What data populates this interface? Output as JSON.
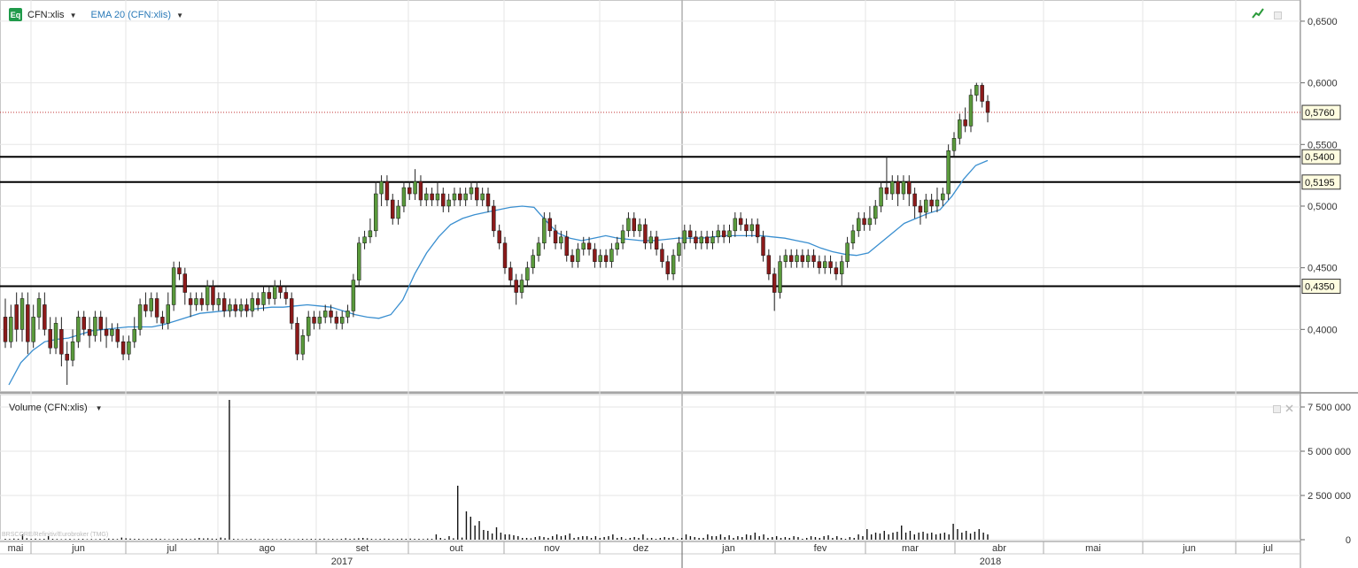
{
  "header": {
    "symbol_label": "CFN:xlis",
    "indicator_label": "EMA 20 (CFN:xlis)",
    "logo_text": "Eq",
    "caret": "▼",
    "volume_label": "Volume (CFN:xlis)"
  },
  "watermark": "BRSCORE/Refinitiv/Eurobroker (TMG)",
  "icons": [
    "chart-type-icon",
    "maximize-icon",
    "pane-settings-icon",
    "close-pane-icon"
  ],
  "colors": {
    "up": "#5a9a3c",
    "down": "#8b1a1a",
    "wick": "#222222",
    "ema": "#3a8fd0",
    "hline": "#000000",
    "last_price_line": "#c03030",
    "grid": "#e6e6e6",
    "grid_major": "#b0b0b0"
  },
  "chart_data": {
    "type": "candlestick",
    "price_axis": {
      "range": [
        0.35,
        0.66
      ],
      "ticks": [
        "0,4000",
        "0,4500",
        "0,5000",
        "0,5500",
        "0,6000",
        "0,6500"
      ],
      "tick_values": [
        0.4,
        0.45,
        0.5,
        0.55,
        0.6,
        0.65
      ]
    },
    "volume_axis": {
      "range": [
        0,
        8000000
      ],
      "ticks": [
        "0",
        "2 500 000",
        "5 000 000",
        "7 500 000"
      ],
      "tick_values": [
        0,
        2500000,
        5000000,
        7500000
      ]
    },
    "horizontal_lines": [
      {
        "value": 0.54,
        "label": "0,5400"
      },
      {
        "value": 0.5195,
        "label": "0,5195"
      },
      {
        "value": 0.435,
        "label": "0,4350"
      }
    ],
    "last_price": {
      "value": 0.576,
      "label": "0,5760"
    },
    "x_axis": {
      "months": [
        {
          "label": "mai",
          "at": 2017.33
        },
        {
          "label": "jun",
          "at": 2017.42
        },
        {
          "label": "jul",
          "at": 2017.5
        },
        {
          "label": "ago",
          "at": 2017.58
        },
        {
          "label": "set",
          "at": 2017.67
        },
        {
          "label": "out",
          "at": 2017.75
        },
        {
          "label": "nov",
          "at": 2017.83
        },
        {
          "label": "dez",
          "at": 2017.92
        },
        {
          "label": "jan",
          "at": 2018.0
        },
        {
          "label": "fev",
          "at": 2018.08
        },
        {
          "label": "mar",
          "at": 2018.17
        },
        {
          "label": "abr",
          "at": 2018.25
        },
        {
          "label": "mai",
          "at": 2018.33
        },
        {
          "label": "jun",
          "at": 2018.42
        },
        {
          "label": "jul",
          "at": 2018.5
        }
      ],
      "years": [
        {
          "label": "2017"
        },
        {
          "label": "2018"
        }
      ]
    },
    "ema_series": [
      0.355,
      0.373,
      0.383,
      0.39,
      0.392,
      0.393,
      0.396,
      0.399,
      0.4,
      0.401,
      0.402,
      0.402,
      0.402,
      0.404,
      0.407,
      0.41,
      0.413,
      0.414,
      0.415,
      0.416,
      0.416,
      0.417,
      0.418,
      0.418,
      0.419,
      0.42,
      0.419,
      0.418,
      0.415,
      0.412,
      0.41,
      0.409,
      0.412,
      0.424,
      0.445,
      0.462,
      0.475,
      0.485,
      0.49,
      0.493,
      0.495,
      0.497,
      0.499,
      0.5,
      0.499,
      0.488,
      0.478,
      0.474,
      0.472,
      0.474,
      0.476,
      0.474,
      0.473,
      0.472,
      0.472,
      0.473,
      0.474,
      0.474,
      0.474,
      0.475,
      0.476,
      0.476,
      0.476,
      0.476,
      0.475,
      0.474,
      0.472,
      0.47,
      0.466,
      0.463,
      0.461,
      0.46,
      0.462,
      0.47,
      0.478,
      0.486,
      0.49,
      0.494,
      0.497,
      0.508,
      0.522,
      0.533,
      0.537
    ],
    "candles": [
      [
        0.41,
        0.39,
        0.425,
        0.385
      ],
      [
        0.39,
        0.41,
        0.42,
        0.385
      ],
      [
        0.42,
        0.4,
        0.43,
        0.39
      ],
      [
        0.4,
        0.425,
        0.43,
        0.39
      ],
      [
        0.42,
        0.39,
        0.43,
        0.38
      ],
      [
        0.39,
        0.41,
        0.42,
        0.385
      ],
      [
        0.41,
        0.425,
        0.43,
        0.4
      ],
      [
        0.42,
        0.4,
        0.43,
        0.395
      ],
      [
        0.4,
        0.385,
        0.41,
        0.38
      ],
      [
        0.385,
        0.405,
        0.41,
        0.38
      ],
      [
        0.4,
        0.38,
        0.41,
        0.37
      ],
      [
        0.38,
        0.375,
        0.39,
        0.355
      ],
      [
        0.375,
        0.39,
        0.4,
        0.37
      ],
      [
        0.39,
        0.41,
        0.415,
        0.385
      ],
      [
        0.41,
        0.4,
        0.415,
        0.395
      ],
      [
        0.4,
        0.395,
        0.41,
        0.385
      ],
      [
        0.395,
        0.41,
        0.415,
        0.39
      ],
      [
        0.41,
        0.4,
        0.415,
        0.39
      ],
      [
        0.4,
        0.395,
        0.41,
        0.385
      ],
      [
        0.395,
        0.4,
        0.405,
        0.39
      ],
      [
        0.4,
        0.39,
        0.405,
        0.385
      ],
      [
        0.39,
        0.38,
        0.395,
        0.375
      ],
      [
        0.38,
        0.39,
        0.395,
        0.375
      ],
      [
        0.39,
        0.4,
        0.41,
        0.385
      ],
      [
        0.4,
        0.42,
        0.425,
        0.395
      ],
      [
        0.42,
        0.415,
        0.43,
        0.41
      ],
      [
        0.415,
        0.425,
        0.43,
        0.41
      ],
      [
        0.425,
        0.41,
        0.43,
        0.405
      ],
      [
        0.41,
        0.405,
        0.415,
        0.4
      ],
      [
        0.405,
        0.42,
        0.43,
        0.4
      ],
      [
        0.42,
        0.45,
        0.455,
        0.415
      ],
      [
        0.45,
        0.445,
        0.455,
        0.44
      ],
      [
        0.445,
        0.43,
        0.45,
        0.42
      ],
      [
        0.425,
        0.42,
        0.43,
        0.41
      ],
      [
        0.42,
        0.425,
        0.43,
        0.415
      ],
      [
        0.425,
        0.42,
        0.43,
        0.415
      ],
      [
        0.42,
        0.435,
        0.44,
        0.415
      ],
      [
        0.435,
        0.42,
        0.44,
        0.415
      ],
      [
        0.42,
        0.425,
        0.43,
        0.415
      ],
      [
        0.425,
        0.415,
        0.43,
        0.41
      ],
      [
        0.415,
        0.42,
        0.425,
        0.41
      ],
      [
        0.42,
        0.415,
        0.425,
        0.41
      ],
      [
        0.415,
        0.42,
        0.425,
        0.41
      ],
      [
        0.42,
        0.415,
        0.425,
        0.41
      ],
      [
        0.415,
        0.425,
        0.43,
        0.41
      ],
      [
        0.425,
        0.42,
        0.43,
        0.415
      ],
      [
        0.42,
        0.43,
        0.435,
        0.415
      ],
      [
        0.43,
        0.425,
        0.435,
        0.42
      ],
      [
        0.425,
        0.435,
        0.44,
        0.42
      ],
      [
        0.435,
        0.43,
        0.44,
        0.425
      ],
      [
        0.43,
        0.425,
        0.435,
        0.42
      ],
      [
        0.425,
        0.405,
        0.43,
        0.4
      ],
      [
        0.405,
        0.38,
        0.41,
        0.375
      ],
      [
        0.38,
        0.395,
        0.4,
        0.375
      ],
      [
        0.395,
        0.41,
        0.415,
        0.39
      ],
      [
        0.41,
        0.405,
        0.415,
        0.4
      ],
      [
        0.405,
        0.41,
        0.415,
        0.4
      ],
      [
        0.41,
        0.415,
        0.42,
        0.405
      ],
      [
        0.415,
        0.41,
        0.42,
        0.405
      ],
      [
        0.41,
        0.405,
        0.415,
        0.4
      ],
      [
        0.405,
        0.41,
        0.415,
        0.4
      ],
      [
        0.41,
        0.415,
        0.42,
        0.405
      ],
      [
        0.415,
        0.44,
        0.445,
        0.41
      ],
      [
        0.44,
        0.47,
        0.475,
        0.435
      ],
      [
        0.47,
        0.475,
        0.48,
        0.465
      ],
      [
        0.475,
        0.48,
        0.49,
        0.47
      ],
      [
        0.48,
        0.51,
        0.52,
        0.475
      ],
      [
        0.51,
        0.52,
        0.525,
        0.5
      ],
      [
        0.52,
        0.505,
        0.525,
        0.5
      ],
      [
        0.505,
        0.49,
        0.51,
        0.485
      ],
      [
        0.49,
        0.5,
        0.505,
        0.485
      ],
      [
        0.5,
        0.515,
        0.52,
        0.495
      ],
      [
        0.515,
        0.51,
        0.52,
        0.505
      ],
      [
        0.51,
        0.52,
        0.53,
        0.505
      ],
      [
        0.52,
        0.505,
        0.525,
        0.5
      ],
      [
        0.505,
        0.51,
        0.515,
        0.5
      ],
      [
        0.51,
        0.505,
        0.515,
        0.5
      ],
      [
        0.505,
        0.51,
        0.52,
        0.5
      ],
      [
        0.51,
        0.5,
        0.515,
        0.495
      ],
      [
        0.5,
        0.505,
        0.51,
        0.495
      ],
      [
        0.505,
        0.51,
        0.515,
        0.5
      ],
      [
        0.51,
        0.505,
        0.515,
        0.5
      ],
      [
        0.505,
        0.51,
        0.515,
        0.5
      ],
      [
        0.51,
        0.515,
        0.52,
        0.505
      ],
      [
        0.515,
        0.505,
        0.52,
        0.5
      ],
      [
        0.505,
        0.51,
        0.515,
        0.5
      ],
      [
        0.51,
        0.5,
        0.515,
        0.495
      ],
      [
        0.5,
        0.48,
        0.505,
        0.475
      ],
      [
        0.48,
        0.47,
        0.485,
        0.465
      ],
      [
        0.47,
        0.45,
        0.475,
        0.445
      ],
      [
        0.45,
        0.44,
        0.455,
        0.435
      ],
      [
        0.44,
        0.43,
        0.445,
        0.42
      ],
      [
        0.43,
        0.44,
        0.445,
        0.425
      ],
      [
        0.44,
        0.45,
        0.455,
        0.435
      ],
      [
        0.45,
        0.46,
        0.465,
        0.445
      ],
      [
        0.46,
        0.47,
        0.475,
        0.455
      ],
      [
        0.47,
        0.49,
        0.495,
        0.465
      ],
      [
        0.49,
        0.48,
        0.495,
        0.475
      ],
      [
        0.48,
        0.47,
        0.485,
        0.465
      ],
      [
        0.47,
        0.475,
        0.48,
        0.465
      ],
      [
        0.475,
        0.46,
        0.48,
        0.455
      ],
      [
        0.46,
        0.455,
        0.465,
        0.45
      ],
      [
        0.455,
        0.465,
        0.47,
        0.45
      ],
      [
        0.465,
        0.47,
        0.475,
        0.46
      ],
      [
        0.47,
        0.465,
        0.475,
        0.46
      ],
      [
        0.465,
        0.455,
        0.47,
        0.45
      ],
      [
        0.455,
        0.46,
        0.465,
        0.45
      ],
      [
        0.46,
        0.455,
        0.465,
        0.45
      ],
      [
        0.455,
        0.465,
        0.47,
        0.45
      ],
      [
        0.465,
        0.47,
        0.475,
        0.46
      ],
      [
        0.47,
        0.48,
        0.485,
        0.465
      ],
      [
        0.48,
        0.49,
        0.495,
        0.475
      ],
      [
        0.49,
        0.48,
        0.495,
        0.475
      ],
      [
        0.48,
        0.485,
        0.49,
        0.475
      ],
      [
        0.485,
        0.47,
        0.49,
        0.465
      ],
      [
        0.47,
        0.475,
        0.48,
        0.465
      ],
      [
        0.475,
        0.465,
        0.48,
        0.46
      ],
      [
        0.465,
        0.455,
        0.47,
        0.45
      ],
      [
        0.455,
        0.445,
        0.46,
        0.44
      ],
      [
        0.445,
        0.46,
        0.465,
        0.44
      ],
      [
        0.46,
        0.47,
        0.475,
        0.455
      ],
      [
        0.47,
        0.48,
        0.485,
        0.465
      ],
      [
        0.48,
        0.475,
        0.485,
        0.47
      ],
      [
        0.475,
        0.47,
        0.48,
        0.465
      ],
      [
        0.47,
        0.475,
        0.48,
        0.465
      ],
      [
        0.475,
        0.47,
        0.48,
        0.465
      ],
      [
        0.47,
        0.475,
        0.48,
        0.465
      ],
      [
        0.475,
        0.48,
        0.485,
        0.47
      ],
      [
        0.48,
        0.475,
        0.485,
        0.47
      ],
      [
        0.475,
        0.48,
        0.485,
        0.47
      ],
      [
        0.48,
        0.49,
        0.495,
        0.475
      ],
      [
        0.49,
        0.485,
        0.495,
        0.48
      ],
      [
        0.485,
        0.48,
        0.49,
        0.475
      ],
      [
        0.48,
        0.485,
        0.49,
        0.475
      ],
      [
        0.485,
        0.475,
        0.49,
        0.47
      ],
      [
        0.475,
        0.46,
        0.48,
        0.455
      ],
      [
        0.46,
        0.445,
        0.465,
        0.44
      ],
      [
        0.445,
        0.43,
        0.45,
        0.415
      ],
      [
        0.43,
        0.455,
        0.46,
        0.425
      ],
      [
        0.455,
        0.46,
        0.465,
        0.45
      ],
      [
        0.46,
        0.455,
        0.465,
        0.45
      ],
      [
        0.455,
        0.46,
        0.465,
        0.45
      ],
      [
        0.46,
        0.455,
        0.465,
        0.45
      ],
      [
        0.455,
        0.46,
        0.465,
        0.45
      ],
      [
        0.46,
        0.455,
        0.465,
        0.45
      ],
      [
        0.455,
        0.45,
        0.46,
        0.445
      ],
      [
        0.45,
        0.455,
        0.46,
        0.445
      ],
      [
        0.455,
        0.45,
        0.46,
        0.445
      ],
      [
        0.45,
        0.445,
        0.455,
        0.44
      ],
      [
        0.445,
        0.455,
        0.46,
        0.435
      ],
      [
        0.455,
        0.47,
        0.475,
        0.45
      ],
      [
        0.47,
        0.48,
        0.485,
        0.465
      ],
      [
        0.48,
        0.49,
        0.495,
        0.475
      ],
      [
        0.49,
        0.485,
        0.495,
        0.48
      ],
      [
        0.485,
        0.49,
        0.5,
        0.48
      ],
      [
        0.49,
        0.5,
        0.505,
        0.485
      ],
      [
        0.5,
        0.515,
        0.52,
        0.495
      ],
      [
        0.515,
        0.51,
        0.54,
        0.505
      ],
      [
        0.51,
        0.52,
        0.525,
        0.505
      ],
      [
        0.52,
        0.51,
        0.525,
        0.5
      ],
      [
        0.51,
        0.52,
        0.525,
        0.505
      ],
      [
        0.52,
        0.51,
        0.525,
        0.5
      ],
      [
        0.51,
        0.5,
        0.515,
        0.49
      ],
      [
        0.5,
        0.495,
        0.505,
        0.485
      ],
      [
        0.495,
        0.505,
        0.51,
        0.49
      ],
      [
        0.505,
        0.5,
        0.51,
        0.495
      ],
      [
        0.5,
        0.505,
        0.515,
        0.495
      ],
      [
        0.505,
        0.51,
        0.515,
        0.5
      ],
      [
        0.51,
        0.545,
        0.55,
        0.505
      ],
      [
        0.545,
        0.555,
        0.56,
        0.54
      ],
      [
        0.555,
        0.57,
        0.575,
        0.55
      ],
      [
        0.57,
        0.565,
        0.58,
        0.56
      ],
      [
        0.565,
        0.59,
        0.595,
        0.56
      ],
      [
        0.59,
        0.598,
        0.6,
        0.585
      ],
      [
        0.598,
        0.585,
        0.6,
        0.58
      ],
      [
        0.585,
        0.576,
        0.59,
        0.568
      ]
    ],
    "volumes": [
      0.05,
      0.04,
      0.06,
      0.05,
      0.3,
      0.08,
      0.05,
      0.06,
      0.04,
      0.05,
      0.2,
      0.05,
      0.04,
      0.03,
      0.04,
      0.05,
      0.03,
      0.04,
      0.05,
      0.03,
      0.04,
      0.03,
      0.05,
      0.04,
      0.06,
      0.05,
      0.04,
      0.12,
      0.08,
      0.06,
      0.05,
      0.05,
      0.04,
      0.04,
      0.05,
      0.06,
      0.05,
      0.04,
      0.03,
      0.04,
      0.05,
      0.06,
      0.05,
      0.04,
      0.06,
      0.1,
      0.07,
      0.08,
      0.06,
      0.05,
      0.12,
      0.08,
      7.9,
      0.05,
      0.04,
      0.03,
      0.04,
      0.05,
      0.04,
      0.03,
      0.04,
      0.05,
      0.04,
      0.03,
      0.04,
      0.05,
      0.04,
      0.03,
      0.04,
      0.05,
      0.04,
      0.05,
      0.04,
      0.05,
      0.06,
      0.04,
      0.05,
      0.04,
      0.05,
      0.08,
      0.05,
      0.06,
      0.08,
      0.1,
      0.08,
      0.05,
      0.04,
      0.05,
      0.06,
      0.05,
      0.04,
      0.05,
      0.06,
      0.05,
      0.06,
      0.05,
      0.05,
      0.04,
      0.06,
      0.05,
      0.3,
      0.1,
      0.05,
      0.2,
      0.08,
      3.05,
      0.12,
      1.6,
      1.3,
      0.8,
      1.05,
      0.55,
      0.5,
      0.35,
      0.7,
      0.4,
      0.3,
      0.3,
      0.25,
      0.2,
      0.1,
      0.1,
      0.08,
      0.15,
      0.2,
      0.15,
      0.1,
      0.2,
      0.3,
      0.2,
      0.25,
      0.35,
      0.1,
      0.15,
      0.2,
      0.2,
      0.1,
      0.2,
      0.1,
      0.15,
      0.2,
      0.3,
      0.1,
      0.15,
      0.05,
      0.1,
      0.15,
      0.1,
      0.3,
      0.08,
      0.1,
      0.05,
      0.1,
      0.15,
      0.1,
      0.15,
      0.05,
      0.1,
      0.3,
      0.2,
      0.15,
      0.1,
      0.1,
      0.3,
      0.2,
      0.2,
      0.3,
      0.15,
      0.25,
      0.1,
      0.2,
      0.15,
      0.3,
      0.25,
      0.4,
      0.2,
      0.3,
      0.1,
      0.15,
      0.2,
      0.1,
      0.15,
      0.1,
      0.2,
      0.15,
      0.05,
      0.1,
      0.2,
      0.15,
      0.1,
      0.2,
      0.25,
      0.1,
      0.2,
      0.1,
      0.05,
      0.15,
      0.1,
      0.3,
      0.2,
      0.6,
      0.3,
      0.4,
      0.35,
      0.5,
      0.3,
      0.4,
      0.45,
      0.8,
      0.4,
      0.5,
      0.3,
      0.4,
      0.45,
      0.35,
      0.4,
      0.3,
      0.35,
      0.4,
      0.3,
      0.9,
      0.6,
      0.4,
      0.5,
      0.35,
      0.45,
      0.6,
      0.4,
      0.3
    ]
  }
}
